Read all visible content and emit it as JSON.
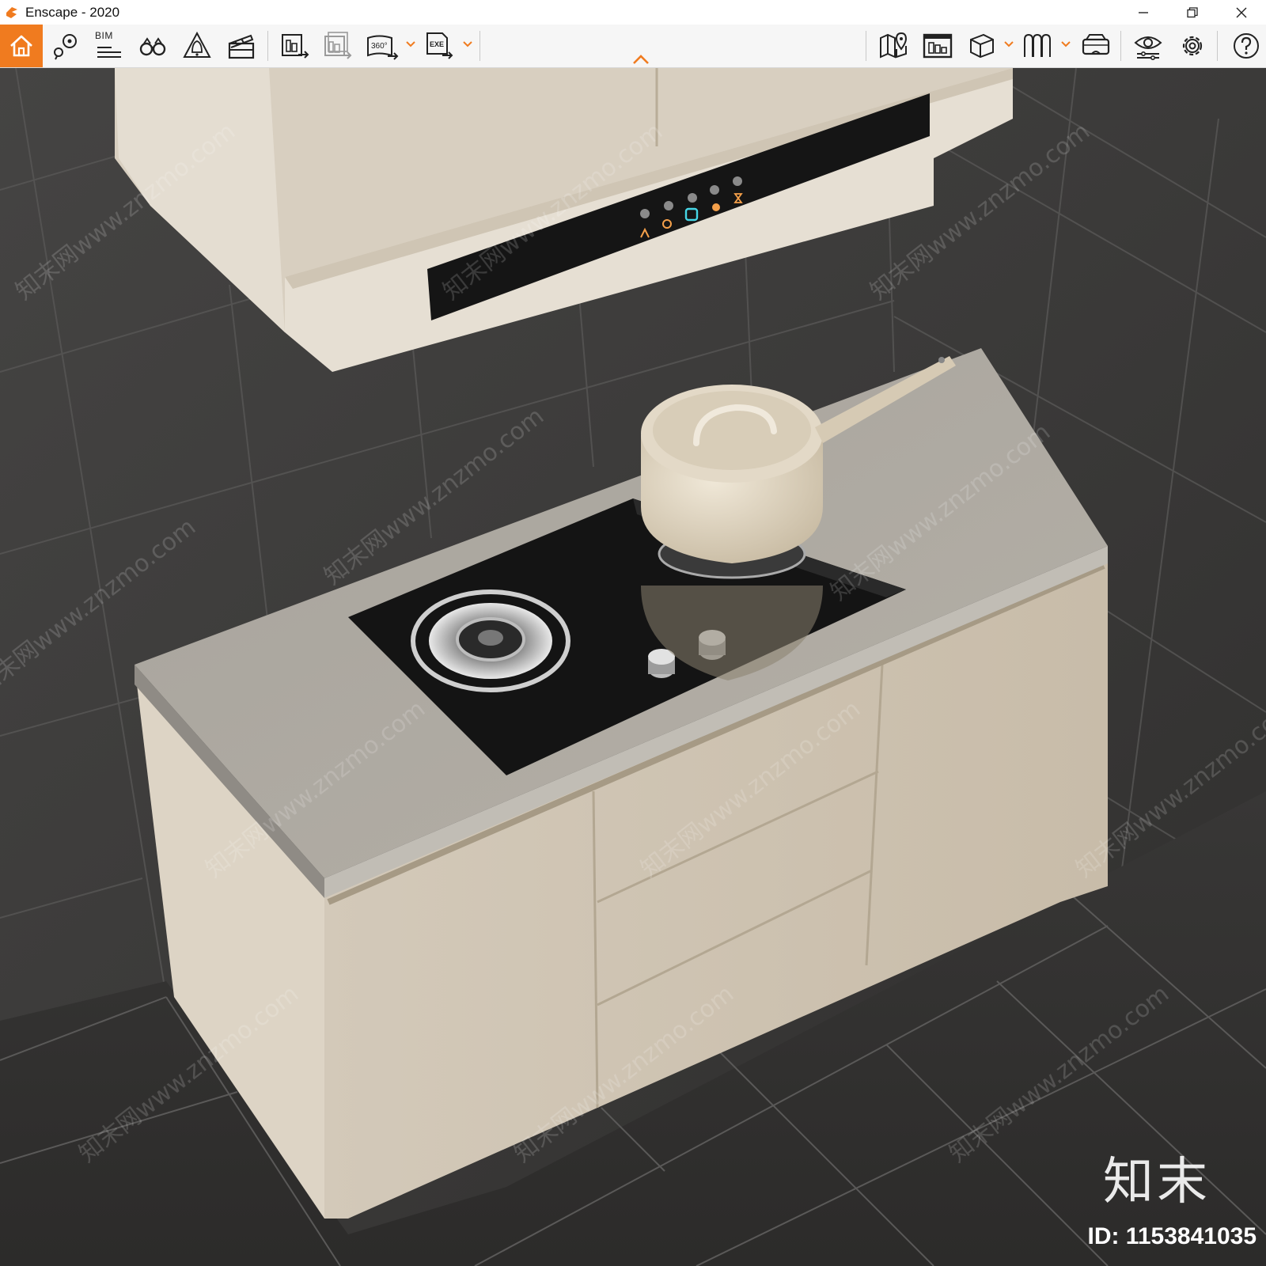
{
  "window": {
    "title": "Enscape - 2020"
  },
  "toolbar": {
    "bim_label": "BIM",
    "buttons": [
      {
        "name": "home-button",
        "icon": "home-icon"
      },
      {
        "name": "view-management-button",
        "icon": "location-pin-icon"
      },
      {
        "name": "bim-info-button",
        "icon": "bim-list-icon"
      },
      {
        "name": "walk-mode-button",
        "icon": "binoculars-icon"
      },
      {
        "name": "atmosphere-button",
        "icon": "bell-triangle-icon"
      },
      {
        "name": "video-editor-button",
        "icon": "clapperboard-icon"
      },
      {
        "name": "screenshot-button",
        "icon": "render-image-icon"
      },
      {
        "name": "batch-render-button",
        "icon": "batch-render-icon"
      },
      {
        "name": "panorama-button",
        "icon": "panorama-360-icon"
      },
      {
        "name": "export-exe-button",
        "icon": "exe-export-icon"
      },
      {
        "name": "map-button",
        "icon": "map-icon"
      },
      {
        "name": "render-window-button",
        "icon": "render-window-icon"
      },
      {
        "name": "asset-library-button",
        "icon": "cube-icon"
      },
      {
        "name": "materials-button",
        "icon": "material-tiles-icon"
      },
      {
        "name": "vr-headset-button",
        "icon": "vr-headset-icon"
      },
      {
        "name": "visual-settings-button",
        "icon": "eye-settings-icon"
      },
      {
        "name": "settings-button",
        "icon": "gear-icon"
      },
      {
        "name": "help-button",
        "icon": "help-icon"
      }
    ]
  },
  "watermark": {
    "logo": "知末",
    "id": "ID: 1153841035"
  },
  "colors": {
    "accent": "#f07b1f",
    "toolbar": "#f6f6f6",
    "tile": "#3c3b3a",
    "cabinet": "#dcd3c4",
    "counter": "#aaa69f"
  }
}
